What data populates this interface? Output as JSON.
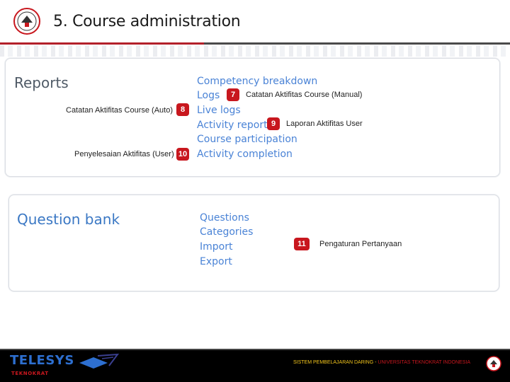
{
  "slide": {
    "title": "5. Course administration"
  },
  "reports": {
    "heading": "Reports",
    "links": [
      {
        "label": "Competency breakdown"
      },
      {
        "label": "Logs"
      },
      {
        "label": "Live logs"
      },
      {
        "label": "Activity report"
      },
      {
        "label": "Course participation"
      },
      {
        "label": "Activity completion"
      }
    ],
    "annotations": [
      {
        "number": "7",
        "text": "Catatan Aktifitas Course (Manual)"
      },
      {
        "number": "8",
        "text": "Catatan Aktifitas Course (Auto)"
      },
      {
        "number": "9",
        "text": "Laporan Aktifitas User"
      },
      {
        "number": "10",
        "text": "Penyelesaian Aktifitas (User)"
      }
    ]
  },
  "question_bank": {
    "heading": "Question bank",
    "links": [
      {
        "label": "Questions"
      },
      {
        "label": "Categories"
      },
      {
        "label": "Import"
      },
      {
        "label": "Export"
      }
    ],
    "annotation": {
      "number": "11",
      "text": "Pengaturan Pertanyaan"
    }
  },
  "footer": {
    "brand": "TELESYS",
    "brand_sub": "TEKNOKRAT",
    "caption_part1": "SISTEM PEMBELAJARAN DARING",
    "caption_sep": " - ",
    "caption_part2": "UNIVERSITAS TEKNOKRAT INDONESIA"
  },
  "colors": {
    "accent": "#c8171e",
    "link": "#4a83d6",
    "brand": "#2d6fd0",
    "footer_bg": "#000000"
  }
}
